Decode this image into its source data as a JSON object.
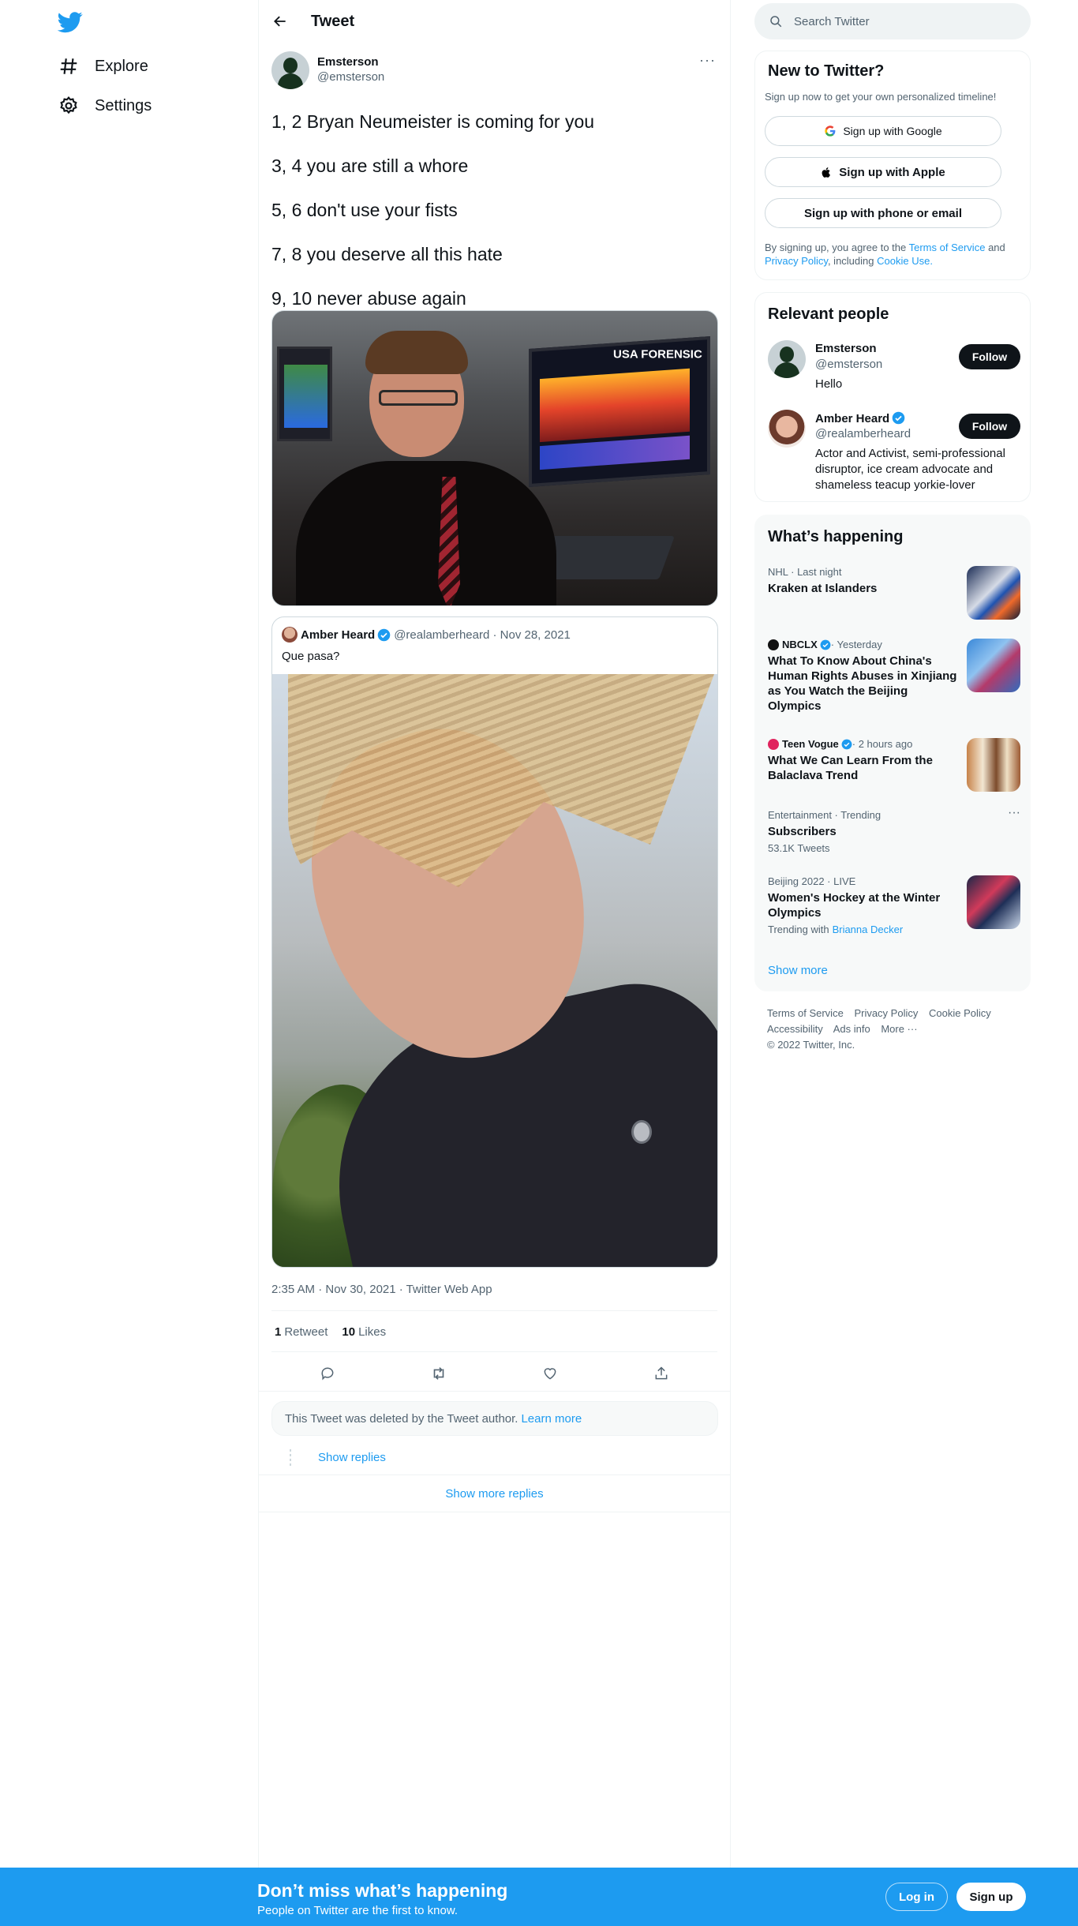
{
  "nav": {
    "items": [
      {
        "label": "Explore",
        "icon": "hashtag-icon"
      },
      {
        "label": "Settings",
        "icon": "gear-icon"
      }
    ]
  },
  "header": {
    "title": "Tweet"
  },
  "tweet": {
    "author_name": "Emsterson",
    "author_handle": "@emsterson",
    "lines": [
      "1, 2 Bryan Neumeister is coming for you",
      "3, 4 you are still a whore",
      "5, 6 don't use your fists",
      "7, 8 you deserve all this hate",
      "9, 10 never abuse again"
    ],
    "photo_sign_text": "USA FORENSIC",
    "quote": {
      "name": "Amber Heard",
      "handle_date": "@realamberheard · Nov 28, 2021",
      "text": "Que pasa?"
    },
    "meta": "2:35 AM · Nov 30, 2021 · Twitter Web App",
    "retweets_count": "1",
    "retweets_label": "Retweet",
    "likes_count": "10",
    "likes_label": "Likes",
    "deleted_text": "This Tweet was deleted by the Tweet author.",
    "learn_more": "Learn more",
    "show_replies": "Show replies",
    "show_more_replies": "Show more replies"
  },
  "sidebar": {
    "search_placeholder": "Search Twitter",
    "signup": {
      "title": "New to Twitter?",
      "subtitle": "Sign up now to get your own personalized timeline!",
      "google": "Sign up with Google",
      "apple": "Sign up with Apple",
      "phone": "Sign up with phone or email",
      "legal_1": "By signing up, you agree to the",
      "legal_tos": "Terms of Service",
      "legal_and": "and",
      "legal_privacy": "Privacy Policy",
      "legal_including": ", including",
      "legal_cookie": "Cookie Use."
    },
    "relevant": {
      "title": "Relevant people",
      "people": [
        {
          "name": "Emsterson",
          "handle": "@emsterson",
          "bio": "Hello",
          "button": "Follow"
        },
        {
          "name": "Amber Heard",
          "handle": "@realamberheard",
          "bio": "Actor and Activist, semi-professional disruptor, ice cream advocate and shameless teacup yorkie-lover",
          "button": "Follow"
        }
      ]
    },
    "happening": {
      "title": "What’s happening",
      "trends": [
        {
          "context": "NHL · Last night",
          "title": "Kraken at Islanders"
        },
        {
          "source": "NBCLX",
          "context": " · Yesterday",
          "title": "What To Know About China's Human Rights Abuses in Xinjiang as You Watch the Beijing Olympics"
        },
        {
          "source": "Teen Vogue",
          "context": " · 2 hours ago",
          "title": "What We Can Learn From the Balaclava Trend"
        },
        {
          "context": "Entertainment · Trending",
          "title": "Subscribers",
          "sub": "53.1K Tweets"
        },
        {
          "context": "Beijing 2022 · LIVE",
          "title": "Women's Hockey at the Winter Olympics",
          "sub": "Trending with",
          "sub_link": "Brianna Decker"
        }
      ],
      "show_more": "Show more"
    },
    "footer": {
      "links": [
        "Terms of Service",
        "Privacy Policy",
        "Cookie Policy",
        "Accessibility",
        "Ads info",
        "More ···"
      ],
      "copyright": "© 2022 Twitter, Inc."
    }
  },
  "banner": {
    "headline": "Don’t miss what’s happening",
    "sub": "People on Twitter are the first to know.",
    "login": "Log in",
    "signup": "Sign up"
  },
  "colors": {
    "accent": "#1d9bf0",
    "text": "#0f1419",
    "muted": "#536471"
  }
}
